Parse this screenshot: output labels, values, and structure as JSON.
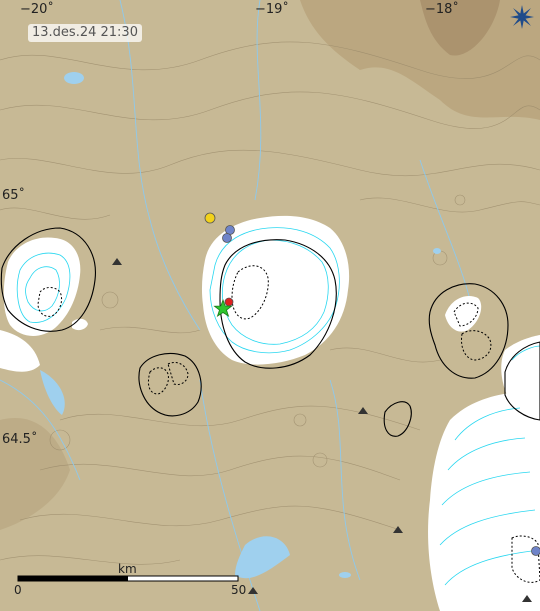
{
  "timestamp": "13.des.24  21:30",
  "longitude_ticks": [
    "−20˚",
    "−19˚",
    "−18˚"
  ],
  "latitude_ticks": [
    "65˚",
    "64.5˚"
  ],
  "scale_bar": {
    "unit": "km",
    "start": "0",
    "end": "50"
  },
  "logo": {
    "icon": "compass-star-icon",
    "color": "#1e4b8a"
  },
  "markers": [
    {
      "type": "triangle-station",
      "color": "#333333"
    },
    {
      "type": "earthquake-dot",
      "color": "#f2d21b"
    },
    {
      "type": "earthquake-dot",
      "color": "#6f84c9"
    },
    {
      "type": "earthquake-dot",
      "color": "#e02020"
    },
    {
      "type": "largest-quake-star",
      "color": "#2ec52e"
    }
  ],
  "colors": {
    "terrain": "#c7b995",
    "glacier": "#ffffff",
    "glacier_contour": "#28d7f0",
    "water": "#9fd0ee",
    "contour": "#9a8a6a"
  }
}
